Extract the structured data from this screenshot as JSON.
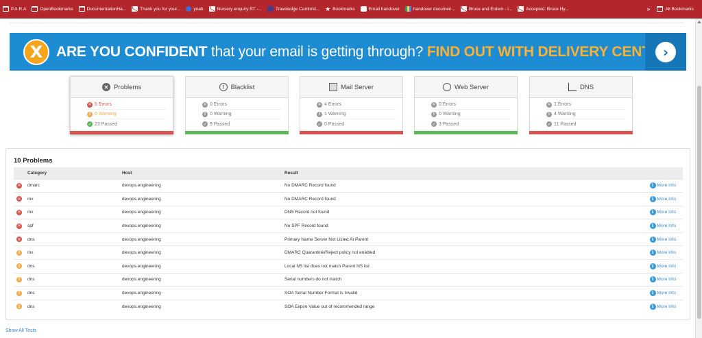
{
  "bookmarks": [
    {
      "label": "P.A.R.A",
      "icon": "folder-icon"
    },
    {
      "label": "OpenBookmarks",
      "icon": "folder-icon"
    },
    {
      "label": "DocumentationHa...",
      "icon": "folder-icon"
    },
    {
      "label": "Thank you for your...",
      "icon": "gmail-icon"
    },
    {
      "label": "ynab",
      "icon": "globe-icon"
    },
    {
      "label": "Nursery enquiry RT -...",
      "icon": "gmail-icon"
    },
    {
      "label": "Travelodge Cambrid...",
      "icon": "travelodge-icon"
    },
    {
      "label": "Bookmarks",
      "icon": "star-icon"
    },
    {
      "label": "Email handover",
      "icon": "hackmd-icon"
    },
    {
      "label": "handover documen...",
      "icon": "drive-icon"
    },
    {
      "label": "Bruce and Erdem - i...",
      "icon": "gmail-icon"
    },
    {
      "label": "Accepted: Bruce Hy...",
      "icon": "gmail-icon"
    }
  ],
  "bookmarks_more": "»",
  "all_bookmarks": "All Bookmarks",
  "banner": {
    "part1": "ARE YOU CONFIDENT",
    "part2": " that your email is getting through? ",
    "part3": "FIND OUT WITH DELIVERY CENTER",
    "x_glyph": "X",
    "arrow_glyph": "›",
    "accent": "#f9b233",
    "background": "#1d8cd3"
  },
  "summary": [
    {
      "title": "Problems",
      "icon": "error-circle-icon",
      "errors": "5 Errors",
      "warnings": "6 Warning",
      "passed": "23 Passed",
      "status": "red",
      "active": true
    },
    {
      "title": "Blacklist",
      "icon": "exclamation-circle-icon",
      "errors": "0 Errors",
      "warnings": "0 Warning",
      "passed": "9 Passed",
      "status": "green",
      "active": false
    },
    {
      "title": "Mail Server",
      "icon": "envelope-icon",
      "errors": "4 Errors",
      "warnings": "1 Warning",
      "passed": "0 Passed",
      "status": "red",
      "active": false
    },
    {
      "title": "Web Server",
      "icon": "globe-icon",
      "errors": "0 Errors",
      "warnings": "0 Warning",
      "passed": "3 Passed",
      "status": "green",
      "active": false
    },
    {
      "title": "DNS",
      "icon": "chart-icon",
      "errors": "1 Errors",
      "warnings": "4 Warning",
      "passed": "11 Passed",
      "status": "red",
      "active": false
    }
  ],
  "problems": {
    "title": "10 Problems",
    "columns": [
      "Category",
      "Host",
      "Result"
    ],
    "more_info": "More Info",
    "rows": [
      {
        "severity": "error",
        "category": "dmarc",
        "host": "devops.engineering",
        "result": "No DMARC Record found"
      },
      {
        "severity": "error",
        "category": "mx",
        "host": "devops.engineering",
        "result": "No DMARC Record found"
      },
      {
        "severity": "error",
        "category": "mx",
        "host": "devops.engineering",
        "result": "DNS Record not found"
      },
      {
        "severity": "error",
        "category": "spf",
        "host": "devops.engineering",
        "result": "No SPF Record found"
      },
      {
        "severity": "error",
        "category": "dns",
        "host": "devops.engineering",
        "result": "Primary Name Server Not Listed At Parent"
      },
      {
        "severity": "warning",
        "category": "mx",
        "host": "devops.engineering",
        "result": "DMARC Quarantine/Reject policy not enabled"
      },
      {
        "severity": "warning",
        "category": "dns",
        "host": "devops.engineering",
        "result": "Local NS list does not match Parent NS list"
      },
      {
        "severity": "warning",
        "category": "dns",
        "host": "devops.engineering",
        "result": "Serial numbers do not match"
      },
      {
        "severity": "warning",
        "category": "dns",
        "host": "devops.engineering",
        "result": "SOA Serial Number Format is Invalid"
      },
      {
        "severity": "warning",
        "category": "dns",
        "host": "devops.engineering",
        "result": "SOA Expire Value out of recommended range"
      }
    ]
  },
  "show_all": "Show All Tests",
  "colors": {
    "error": "#d9534f",
    "warning": "#f0ad4e",
    "passed": "#5cb85c",
    "link": "#3a87c8",
    "chrome_bar": "#b3262c"
  }
}
